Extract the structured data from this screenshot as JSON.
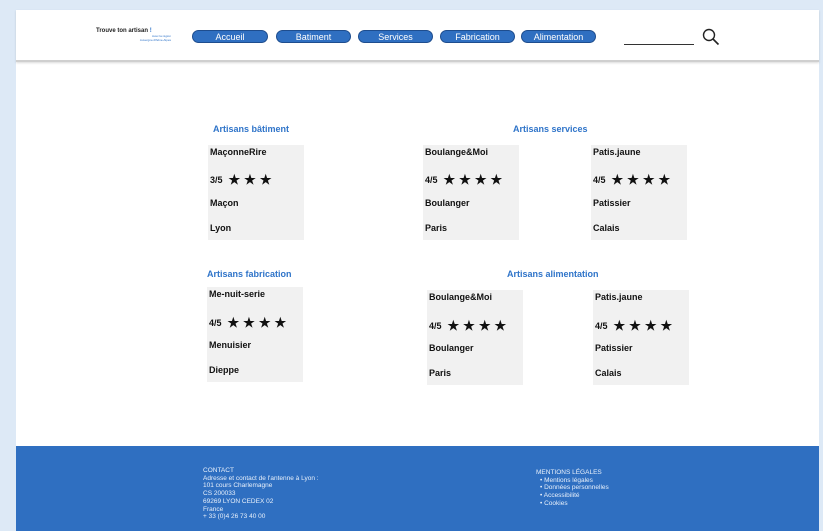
{
  "header": {
    "logo_title_a": "Trouve ton artisan",
    "logo_title_b": "!",
    "logo_sub_1": "Avec la région",
    "logo_sub_2": "Auvergne-Rhône-Alpes",
    "nav": [
      "Accueil",
      "Batiment",
      "Services",
      "Fabrication",
      "Alimentation"
    ],
    "search_icon": "search-icon"
  },
  "sections": {
    "batiment": "Artisans bâtiment",
    "services": "Artisans services",
    "fabrication": "Artisans fabrication",
    "alimentation": "Artisans alimentation"
  },
  "cards": [
    {
      "name": "MaçonneRire",
      "rating": "3/5",
      "stars": "★★★",
      "job": "Maçon",
      "city": "Lyon"
    },
    {
      "name": "Boulange&Moi",
      "rating": "4/5",
      "stars": "★★★★",
      "job": "Boulanger",
      "city": "Paris"
    },
    {
      "name": "Patis.jaune",
      "rating": "4/5",
      "stars": "★★★★",
      "job": "Patissier",
      "city": "Calais"
    },
    {
      "name": "Me-nuit-serie",
      "rating": "4/5",
      "stars": "★★★★",
      "job": "Menuisier",
      "city": "Dieppe"
    },
    {
      "name": "Boulange&Moi",
      "rating": "4/5",
      "stars": "★★★★",
      "job": "Boulanger",
      "city": "Paris"
    },
    {
      "name": "Patis.jaune",
      "rating": "4/5",
      "stars": "★★★★",
      "job": "Patissier",
      "city": "Calais"
    }
  ],
  "footer": {
    "contact_title": "CONTACT",
    "contact_lines": [
      "Adresse et contact de l'antenne à Lyon :",
      "101 cours Charlemagne",
      "CS 200033",
      "69269 LYON CEDEX 02",
      "France",
      "+ 33 (0)4 26 73 40 00"
    ],
    "legal_title": "MENTIONS LÉGALES",
    "legal_items": [
      "Mentions légales",
      "Données personnelles",
      "Accessibilité",
      "Cookies"
    ]
  }
}
